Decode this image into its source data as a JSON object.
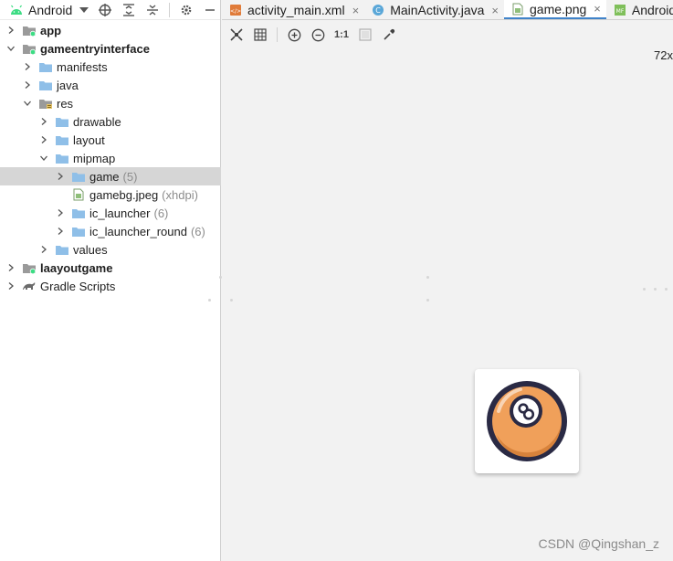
{
  "project_panel": {
    "view_selector": "Android",
    "tree": [
      {
        "label": "app",
        "bold": true,
        "depth": 0,
        "expanded": false,
        "icon": "module-folder-icon"
      },
      {
        "label": "gameentryinterface",
        "bold": true,
        "depth": 0,
        "expanded": true,
        "icon": "module-folder-icon"
      },
      {
        "label": "manifests",
        "depth": 1,
        "expanded": false,
        "icon": "folder-icon"
      },
      {
        "label": "java",
        "depth": 1,
        "expanded": false,
        "icon": "folder-icon"
      },
      {
        "label": "res",
        "depth": 1,
        "expanded": true,
        "icon": "res-folder-icon"
      },
      {
        "label": "drawable",
        "depth": 2,
        "expanded": false,
        "icon": "folder-icon"
      },
      {
        "label": "layout",
        "depth": 2,
        "expanded": false,
        "icon": "folder-icon"
      },
      {
        "label": "mipmap",
        "depth": 2,
        "expanded": true,
        "icon": "folder-icon"
      },
      {
        "label": "game",
        "count": "(5)",
        "depth": 3,
        "expanded": false,
        "selected": true,
        "icon": "folder-icon"
      },
      {
        "label": "gamebg.jpeg",
        "count": "(xhdpi)",
        "depth": 3,
        "leaf": true,
        "icon": "image-file-icon"
      },
      {
        "label": "ic_launcher",
        "count": "(6)",
        "depth": 3,
        "expanded": false,
        "icon": "folder-icon"
      },
      {
        "label": "ic_launcher_round",
        "count": "(6)",
        "depth": 3,
        "expanded": false,
        "icon": "folder-icon"
      },
      {
        "label": "values",
        "depth": 2,
        "expanded": false,
        "icon": "folder-icon"
      },
      {
        "label": "laayoutgame",
        "bold": true,
        "depth": 0,
        "expanded": false,
        "icon": "module-folder-icon"
      },
      {
        "label": "Gradle Scripts",
        "depth": 0,
        "expanded": false,
        "icon": "gradle-icon"
      }
    ]
  },
  "tabs": [
    {
      "label": "activity_main.xml",
      "icon": "xml-file-icon",
      "active": false
    },
    {
      "label": "MainActivity.java",
      "icon": "class-file-icon",
      "active": false
    },
    {
      "label": "game.png",
      "icon": "image-file-icon",
      "active": true
    },
    {
      "label": "AndroidMa",
      "icon": "manifest-file-icon",
      "active": false
    }
  ],
  "image_toolbar": {
    "actual_size_label": "1:1",
    "zoom_level": "72x"
  },
  "watermark": "CSDN @Qingshan_z",
  "colors": {
    "accent": "#4083c9",
    "folder": "#8fbfe8",
    "ball_orange": "#f0a05a",
    "ball_outline": "#2a2a44"
  }
}
